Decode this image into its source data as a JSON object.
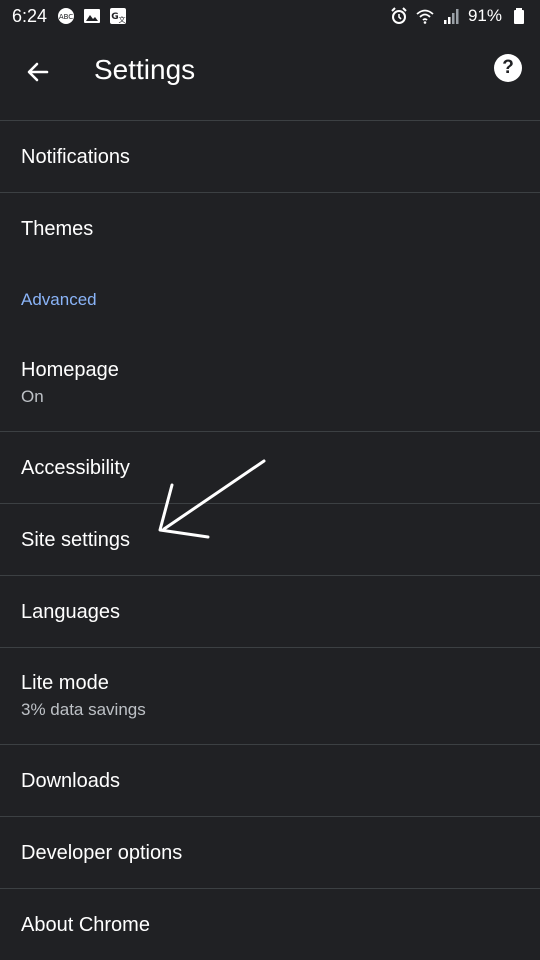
{
  "status_bar": {
    "time": "6:24",
    "battery": "91%",
    "left_icons": [
      "data-saver-icon",
      "image-icon",
      "translate-icon"
    ],
    "right_icons": [
      "alarm-icon",
      "wifi-icon",
      "signal-icon",
      "battery-icon"
    ]
  },
  "app_bar": {
    "title": "Settings",
    "back_icon": "arrow-left-icon",
    "help_icon": "help-circle-icon"
  },
  "settings": {
    "notifications": "Notifications",
    "themes": "Themes",
    "advanced_header": "Advanced",
    "homepage": {
      "title": "Homepage",
      "subtitle": "On"
    },
    "accessibility": "Accessibility",
    "site_settings": "Site settings",
    "languages": "Languages",
    "lite_mode": {
      "title": "Lite mode",
      "subtitle": "3% data savings"
    },
    "downloads": "Downloads",
    "developer_options": "Developer options",
    "about_chrome": "About Chrome"
  },
  "colors": {
    "background": "#202124",
    "accent": "#8ab4f8",
    "divider": "#3c4043",
    "text": "#ffffff",
    "secondary_text": "#bdc1c6"
  }
}
